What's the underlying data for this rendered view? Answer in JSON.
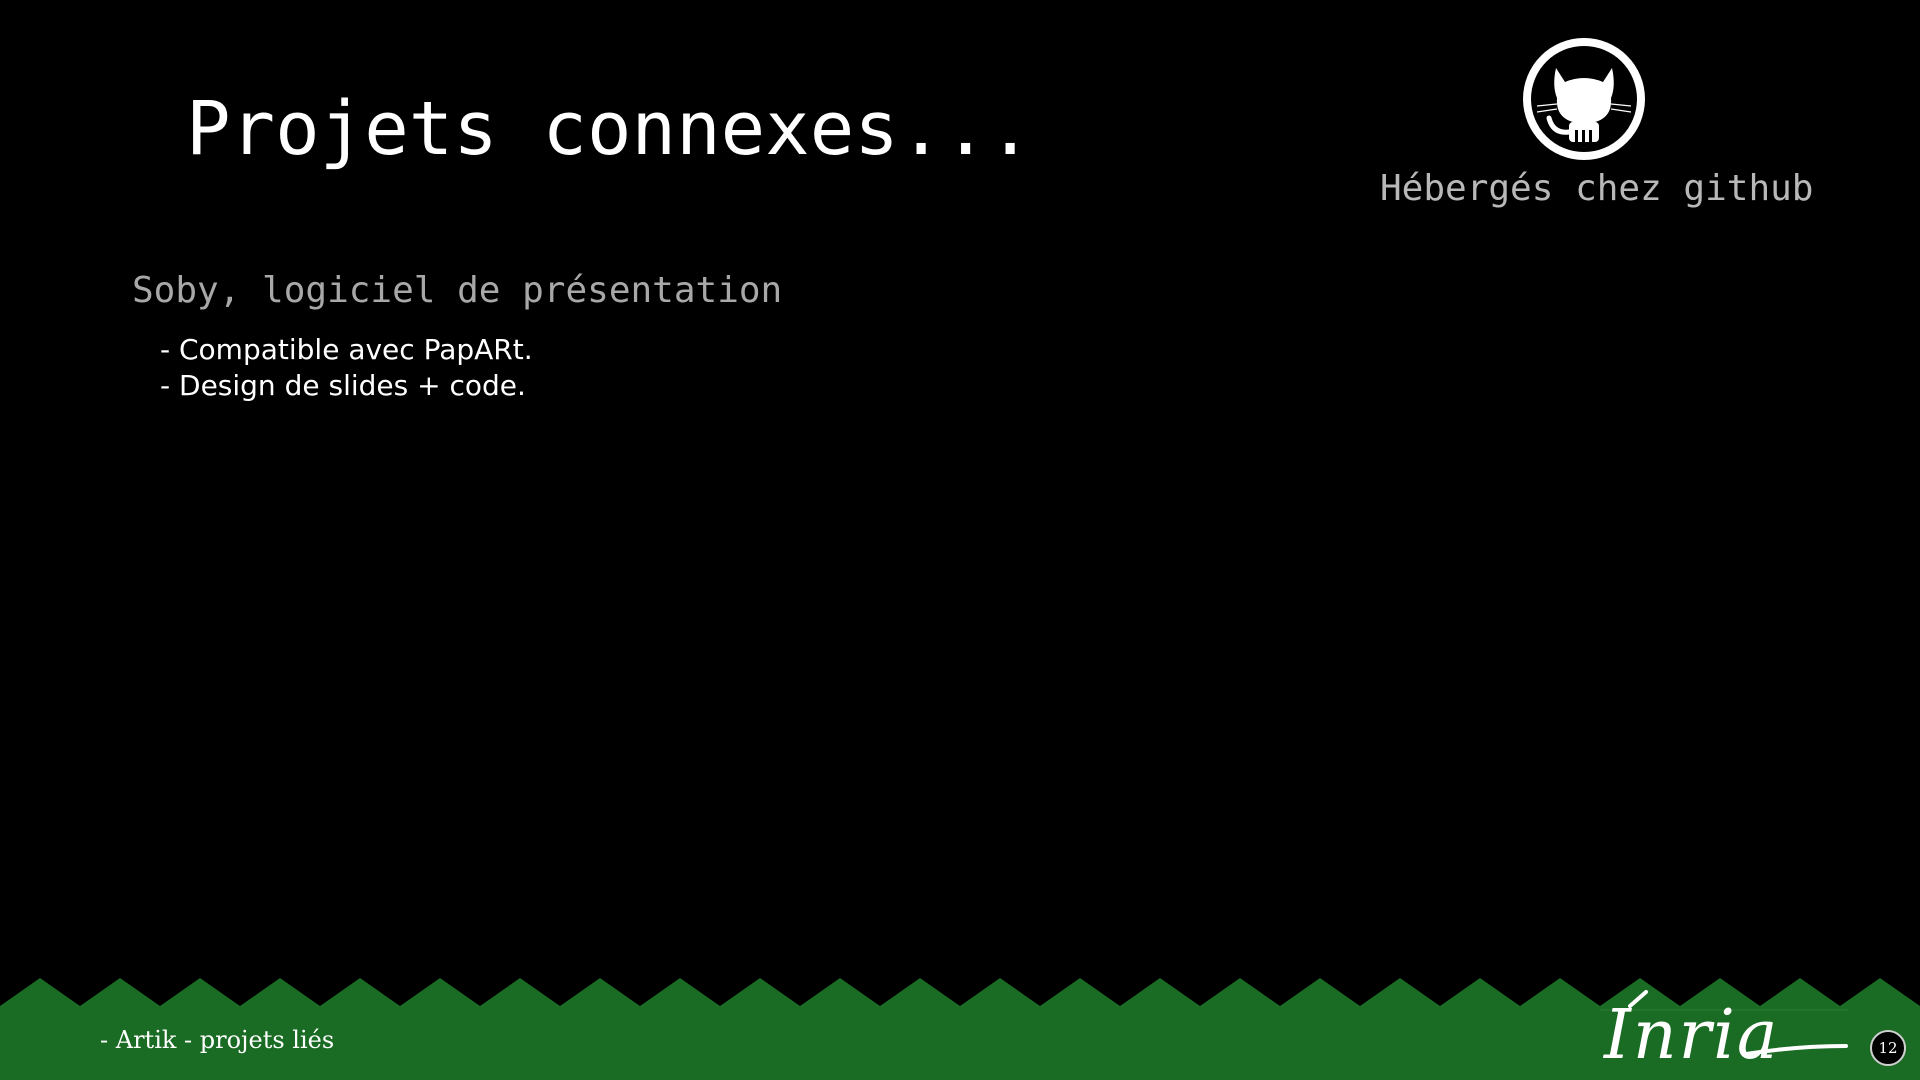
{
  "slide": {
    "title": "Projets connexes...",
    "github": {
      "icon": "github-octocat-icon",
      "caption": "Hébergés chez github"
    },
    "subtitle": "Soby, logiciel de présentation",
    "bullets": [
      "- Compatible avec PapARt.",
      "- Design de slides + code."
    ]
  },
  "footer": {
    "text": "- Artik - projets liés",
    "logo": "Inria",
    "page_number": "12",
    "colors": {
      "band": "#1a6b23",
      "background": "#000000"
    }
  }
}
